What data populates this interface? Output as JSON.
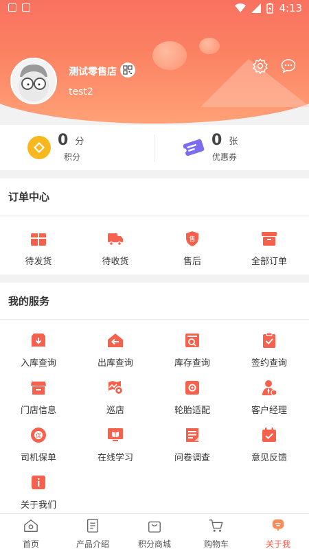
{
  "status_bar": {
    "time": "4:13"
  },
  "header": {
    "store_name": "测试零售店",
    "username": "test2"
  },
  "points": {
    "score_value": "0",
    "score_unit": "分",
    "score_label": "积分",
    "coupon_value": "0",
    "coupon_unit": "张",
    "coupon_label": "优惠券"
  },
  "orders": {
    "title": "订单中心",
    "items": [
      {
        "label": "待发货",
        "icon": "gift-box-icon"
      },
      {
        "label": "待收货",
        "icon": "truck-icon"
      },
      {
        "label": "售后",
        "icon": "after-sale-shield-icon"
      },
      {
        "label": "全部订单",
        "icon": "archive-box-icon"
      }
    ]
  },
  "services": {
    "title": "我的服务",
    "items": [
      {
        "label": "入库查询",
        "icon": "inbound-box-icon"
      },
      {
        "label": "出库查询",
        "icon": "outbound-house-icon"
      },
      {
        "label": "库存查询",
        "icon": "inventory-search-icon"
      },
      {
        "label": "签约查询",
        "icon": "contract-clipboard-icon"
      },
      {
        "label": "门店信息",
        "icon": "store-icon"
      },
      {
        "label": "巡店",
        "icon": "patrol-icon"
      },
      {
        "label": "轮胎适配",
        "icon": "tire-icon"
      },
      {
        "label": "客户经理",
        "icon": "manager-icon"
      },
      {
        "label": "司机保单",
        "icon": "insurance-icon"
      },
      {
        "label": "在线学习",
        "icon": "book-screen-icon"
      },
      {
        "label": "问卷调查",
        "icon": "survey-icon"
      },
      {
        "label": "意见反馈",
        "icon": "feedback-calendar-icon"
      },
      {
        "label": "关于我们",
        "icon": "info-icon"
      }
    ]
  },
  "tabbar": {
    "items": [
      {
        "label": "首页",
        "icon": "home-icon"
      },
      {
        "label": "产品介绍",
        "icon": "document-icon"
      },
      {
        "label": "积分商城",
        "icon": "shopping-bag-icon"
      },
      {
        "label": "购物车",
        "icon": "cart-icon"
      },
      {
        "label": "关于我",
        "icon": "profile-chat-icon"
      }
    ]
  },
  "colors": {
    "accent": "#f5614d",
    "header_gradient_top": "#f7665f",
    "header_gradient_bottom": "#ffa177",
    "coin": "#f7b81f",
    "coupon": "#7c6cf0"
  }
}
